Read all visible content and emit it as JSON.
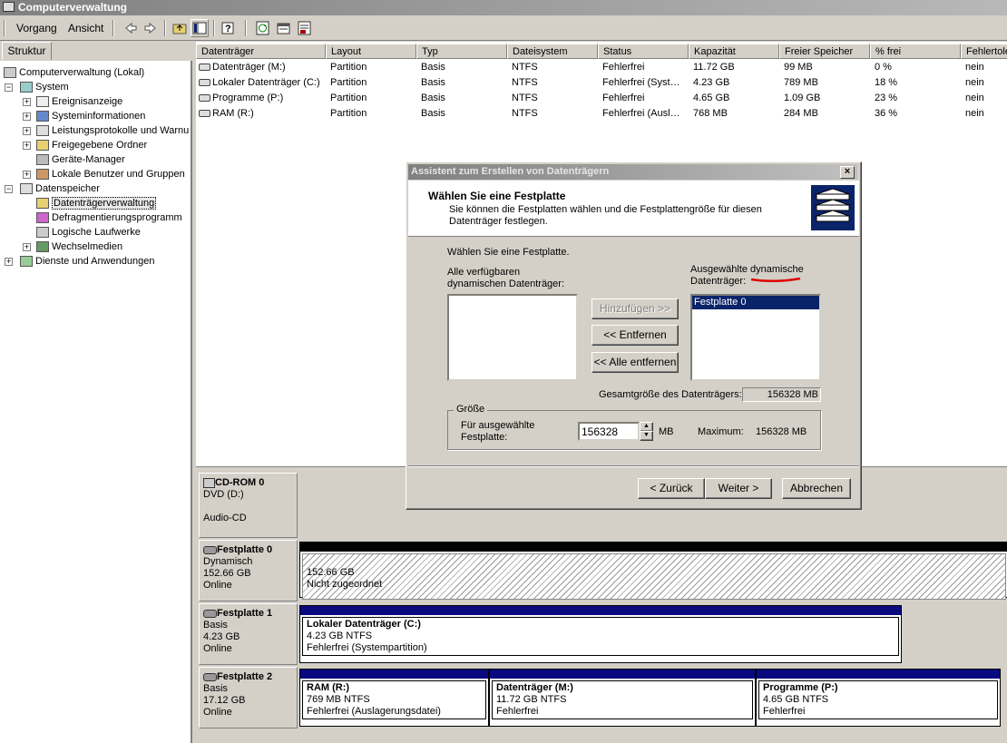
{
  "window": {
    "title": "Computerverwaltung"
  },
  "menu": {
    "action": "Vorgang",
    "view": "Ansicht"
  },
  "toolbar_icons": [
    "back-icon",
    "forward-icon",
    "up-folder-icon",
    "show-tree-icon",
    "help-icon",
    "refresh-icon",
    "properties-icon",
    "export-icon"
  ],
  "left_tab": "Struktur",
  "tree": {
    "root": "Computerverwaltung (Lokal)",
    "system": "System",
    "event_viewer": "Ereignisanzeige",
    "system_info": "Systeminformationen",
    "perf_logs": "Leistungsprotokolle und Warnu",
    "shared_folders": "Freigegebene Ordner",
    "device_manager": "Geräte-Manager",
    "local_users": "Lokale Benutzer und Gruppen",
    "storage": "Datenspeicher",
    "disk_mgmt": "Datenträgerverwaltung",
    "defrag": "Defragmentierungsprogramm",
    "logical_drives": "Logische Laufwerke",
    "removable": "Wechselmedien",
    "services": "Dienste und Anwendungen"
  },
  "table": {
    "headers": [
      "Datenträger",
      "Layout",
      "Typ",
      "Dateisystem",
      "Status",
      "Kapazität",
      "Freier Speicher",
      "% frei",
      "Fehlertole"
    ],
    "rows": [
      [
        "Datenträger (M:)",
        "Partition",
        "Basis",
        "NTFS",
        "Fehlerfrei",
        "11.72 GB",
        "99 MB",
        "0 %",
        "nein"
      ],
      [
        "Lokaler Datenträger (C:)",
        "Partition",
        "Basis",
        "NTFS",
        "Fehlerfrei (Syst…",
        "4.23 GB",
        "789 MB",
        "18 %",
        "nein"
      ],
      [
        "Programme (P:)",
        "Partition",
        "Basis",
        "NTFS",
        "Fehlerfrei",
        "4.65 GB",
        "1.09 GB",
        "23 %",
        "nein"
      ],
      [
        "RAM (R:)",
        "Partition",
        "Basis",
        "NTFS",
        "Fehlerfrei (Ausl…",
        "768 MB",
        "284 MB",
        "36 %",
        "nein"
      ]
    ]
  },
  "disks": {
    "cdrom": {
      "name": "CD-ROM 0",
      "type": "DVD (D:)",
      "media": "Audio-CD"
    },
    "disk0": {
      "name": "Festplatte 0",
      "kind": "Dynamisch",
      "size": "152.66 GB",
      "state": "Online",
      "part_size": "152.66 GB",
      "part_status": "Nicht zugeordnet"
    },
    "disk1": {
      "name": "Festplatte 1",
      "kind": "Basis",
      "size": "4.23 GB",
      "state": "Online",
      "part_name": "Lokaler Datenträger  (C:)",
      "part_size": "4.23 GB NTFS",
      "part_status": "Fehlerfrei (Systempartition)"
    },
    "disk2": {
      "name": "Festplatte 2",
      "kind": "Basis",
      "size": "17.12 GB",
      "state": "Online",
      "parts": [
        {
          "name": "RAM  (R:)",
          "size": "769 MB NTFS",
          "status": "Fehlerfrei (Auslagerungsdatei)"
        },
        {
          "name": "Datenträger  (M:)",
          "size": "11.72 GB NTFS",
          "status": "Fehlerfrei"
        },
        {
          "name": "Programme  (P:)",
          "size": "4.65 GB NTFS",
          "status": "Fehlerfrei"
        }
      ]
    }
  },
  "dialog": {
    "title": "Assistent zum Erstellen von Datenträgern",
    "close": "×",
    "heading": "Wählen Sie eine Festplatte",
    "subheading": "Sie können die Festplatten wählen und die Festplattengröße für diesen Datenträger festlegen.",
    "instruction": "Wählen Sie eine Festplatte.",
    "available_label": "Alle verfügbaren dynamischen Datenträger:",
    "selected_label_1": "Ausgewählte dynamische",
    "selected_label_2": "Datenträger:",
    "selected_items": [
      "Festplatte 0"
    ],
    "add_button": "Hinzufügen >>",
    "remove_button": "<< Entfernen",
    "remove_all_button": "<< Alle entfernen",
    "total_label": "Gesamtgröße des Datenträgers:",
    "total_value": "156328 MB",
    "size_group": "Größe",
    "size_for_label_1": "Für ausgewählte",
    "size_for_label_2": "Festplatte:",
    "size_value": "156328",
    "size_unit": "MB",
    "max_label": "Maximum:",
    "max_value": "156328 MB",
    "back_button": "< Zurück",
    "next_button": "Weiter >",
    "cancel_button": "Abbrechen"
  },
  "colors": {
    "title_gradient_start": "#808080",
    "selection": "#0a246a",
    "disk_bar": "#0a0a80",
    "annotation": "#e00000"
  }
}
